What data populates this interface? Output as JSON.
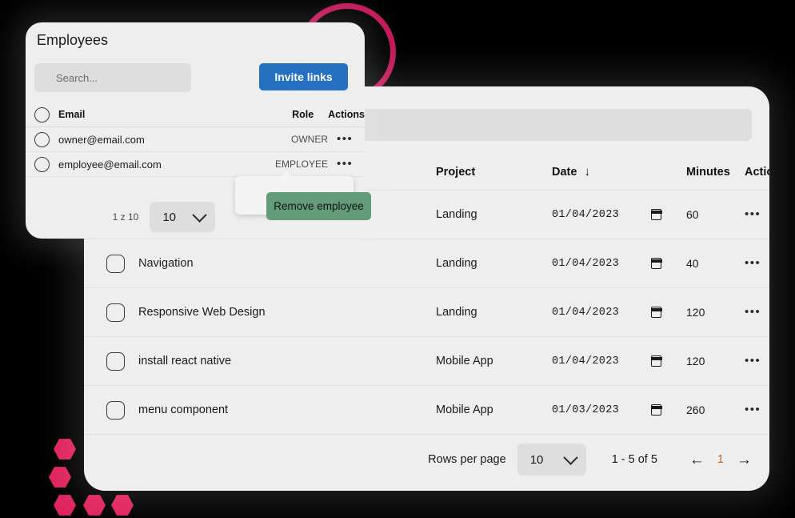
{
  "main_card": {
    "search": {
      "value": "",
      "placeholder": ""
    },
    "table": {
      "headers": {
        "task": "",
        "project": "Project",
        "date": "Date",
        "sort_arrow": "↓",
        "minutes": "Minutes",
        "actions": "Actio…"
      },
      "rows": [
        {
          "task": "",
          "project": "Landing",
          "date": "01/04/2023",
          "minutes": "60",
          "actions": "•••"
        },
        {
          "task": "Navigation",
          "project": "Landing",
          "date": "01/04/2023",
          "minutes": "40",
          "actions": "•••"
        },
        {
          "task": "Responsive Web Design",
          "project": "Landing",
          "date": "01/04/2023",
          "minutes": "120",
          "actions": "•••"
        },
        {
          "task": "install react native",
          "project": "Mobile App",
          "date": "01/04/2023",
          "minutes": "120",
          "actions": "•••"
        },
        {
          "task": "menu component",
          "project": "Mobile App",
          "date": "01/03/2023",
          "minutes": "260",
          "actions": "•••"
        }
      ]
    },
    "pagination": {
      "rows_per_page_label": "Rows per page",
      "rows_per_page_value": "10",
      "range_label": "1 - 5 of 5",
      "prev_icon": "←",
      "current_page": "1",
      "next_icon": "→"
    }
  },
  "employees_modal": {
    "title": "Employees",
    "search": {
      "value": "",
      "placeholder": "Search..."
    },
    "invite_links_label": "Invite links",
    "table": {
      "headers": {
        "email": "Email",
        "role": "Role",
        "actions": "Actions"
      },
      "rows": [
        {
          "email": "owner@email.com",
          "role": "OWNER",
          "actions": "•••"
        },
        {
          "email": "employee@email.com",
          "role": "EMPLOYEE",
          "actions": "•••"
        }
      ]
    },
    "pagination": {
      "count_label": "1 z 10",
      "rows_per_page_value": "10"
    }
  },
  "tooltip": {
    "remove_employee_label": "Remove employee"
  },
  "colors": {
    "accent_blue": "#2570c0",
    "accent_green": "#629c79",
    "accent_crimson": "#c2185b",
    "hex_pink": "#e0245e",
    "card_bg": "#efeeee",
    "field_bg": "#dedede",
    "page_number": "#b06a2a"
  }
}
